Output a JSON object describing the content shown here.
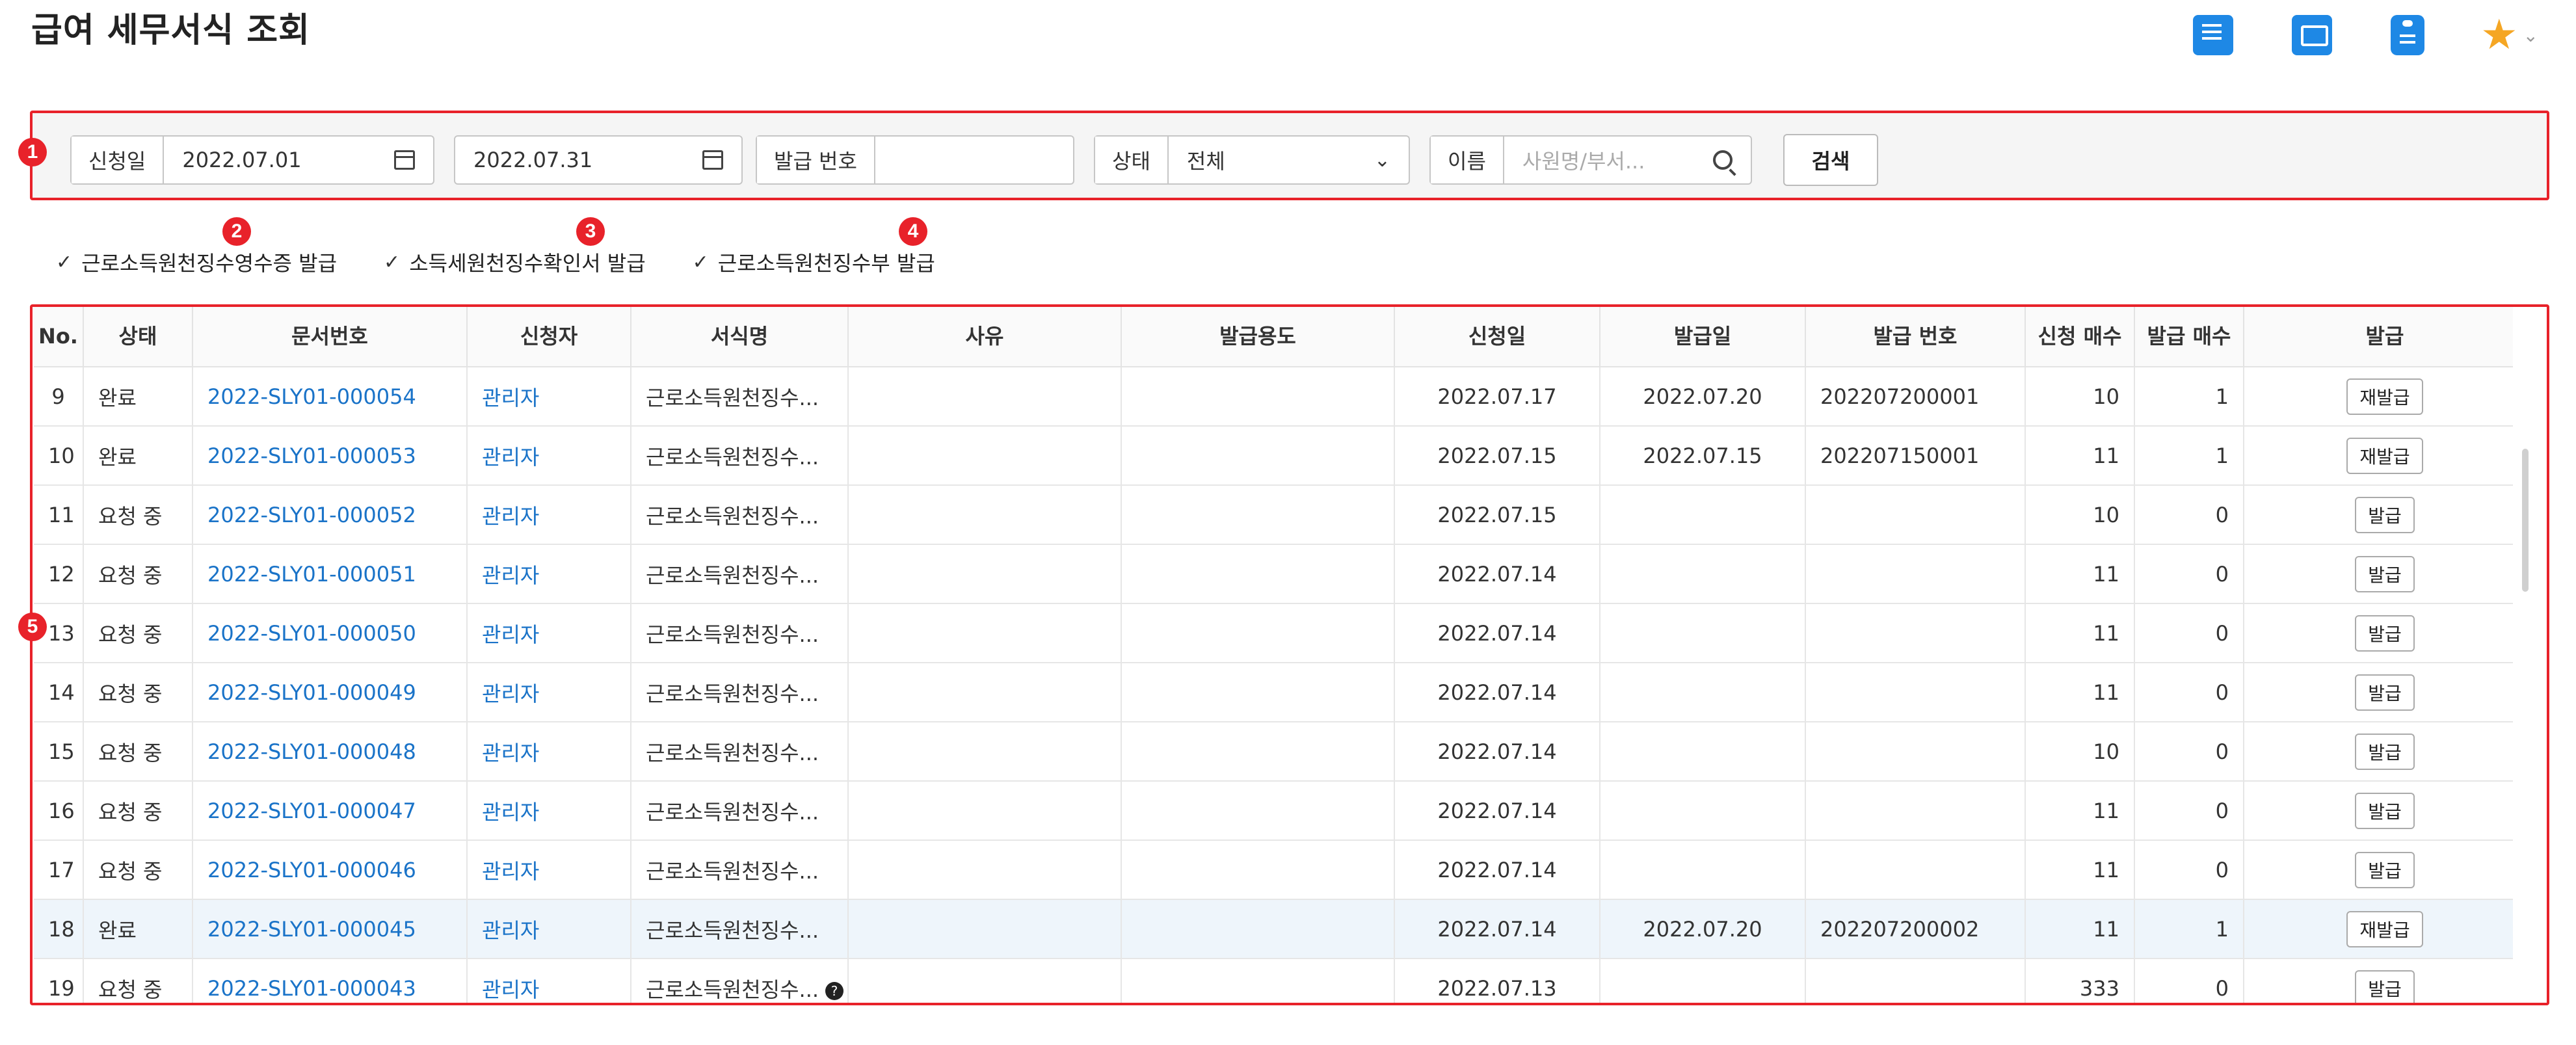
{
  "page": {
    "title": "급여 세무서식 조회"
  },
  "top_icons": [
    "document-icon",
    "message-icon",
    "clipboard-icon",
    "favorite-star-icon"
  ],
  "accent": "#1e88e5",
  "annotation_color": "#e8222a",
  "badges": [
    "1",
    "2",
    "3",
    "4",
    "5"
  ],
  "filters": {
    "date_label": "신청일",
    "date_from": "2022.07.01",
    "date_sep": "~",
    "date_to": "2022.07.31",
    "issue_no_label": "발급 번호",
    "issue_no_value": "",
    "status_label": "상태",
    "status_value": "전체",
    "name_label": "이름",
    "name_placeholder": "사원명/부서...",
    "search_button": "검색"
  },
  "issue_actions": [
    {
      "label": "근로소득원천징수영수증 발급"
    },
    {
      "label": "소득세원천징수확인서 발급"
    },
    {
      "label": "근로소득원천징수부 발급"
    }
  ],
  "table": {
    "columns": [
      "No.",
      "상태",
      "문서번호",
      "신청자",
      "서식명",
      "사유",
      "발급용도",
      "신청일",
      "발급일",
      "발급 번호",
      "신청 매수",
      "발급 매수",
      "발급"
    ],
    "rows": [
      {
        "no": "9",
        "status": "완료",
        "doc_no": "2022-SLY01-000054",
        "applicant": "관리자",
        "form": "근로소득원천징수...",
        "reason": "",
        "purpose": "",
        "applied": "2022.07.17",
        "issued": "2022.07.20",
        "issue_no": "202207200001",
        "req_count": "10",
        "issue_count": "1",
        "action": "재발급"
      },
      {
        "no": "10",
        "status": "완료",
        "doc_no": "2022-SLY01-000053",
        "applicant": "관리자",
        "form": "근로소득원천징수...",
        "reason": "",
        "purpose": "",
        "applied": "2022.07.15",
        "issued": "2022.07.15",
        "issue_no": "202207150001",
        "req_count": "11",
        "issue_count": "1",
        "action": "재발급"
      },
      {
        "no": "11",
        "status": "요청 중",
        "doc_no": "2022-SLY01-000052",
        "applicant": "관리자",
        "form": "근로소득원천징수...",
        "reason": "",
        "purpose": "",
        "applied": "2022.07.15",
        "issued": "",
        "issue_no": "",
        "req_count": "10",
        "issue_count": "0",
        "action": "발급"
      },
      {
        "no": "12",
        "status": "요청 중",
        "doc_no": "2022-SLY01-000051",
        "applicant": "관리자",
        "form": "근로소득원천징수...",
        "reason": "",
        "purpose": "",
        "applied": "2022.07.14",
        "issued": "",
        "issue_no": "",
        "req_count": "11",
        "issue_count": "0",
        "action": "발급"
      },
      {
        "no": "13",
        "status": "요청 중",
        "doc_no": "2022-SLY01-000050",
        "applicant": "관리자",
        "form": "근로소득원천징수...",
        "reason": "",
        "purpose": "",
        "applied": "2022.07.14",
        "issued": "",
        "issue_no": "",
        "req_count": "11",
        "issue_count": "0",
        "action": "발급"
      },
      {
        "no": "14",
        "status": "요청 중",
        "doc_no": "2022-SLY01-000049",
        "applicant": "관리자",
        "form": "근로소득원천징수...",
        "reason": "",
        "purpose": "",
        "applied": "2022.07.14",
        "issued": "",
        "issue_no": "",
        "req_count": "11",
        "issue_count": "0",
        "action": "발급"
      },
      {
        "no": "15",
        "status": "요청 중",
        "doc_no": "2022-SLY01-000048",
        "applicant": "관리자",
        "form": "근로소득원천징수...",
        "reason": "",
        "purpose": "",
        "applied": "2022.07.14",
        "issued": "",
        "issue_no": "",
        "req_count": "10",
        "issue_count": "0",
        "action": "발급"
      },
      {
        "no": "16",
        "status": "요청 중",
        "doc_no": "2022-SLY01-000047",
        "applicant": "관리자",
        "form": "근로소득원천징수...",
        "reason": "",
        "purpose": "",
        "applied": "2022.07.14",
        "issued": "",
        "issue_no": "",
        "req_count": "11",
        "issue_count": "0",
        "action": "발급"
      },
      {
        "no": "17",
        "status": "요청 중",
        "doc_no": "2022-SLY01-000046",
        "applicant": "관리자",
        "form": "근로소득원천징수...",
        "reason": "",
        "purpose": "",
        "applied": "2022.07.14",
        "issued": "",
        "issue_no": "",
        "req_count": "11",
        "issue_count": "0",
        "action": "발급"
      },
      {
        "no": "18",
        "status": "완료",
        "doc_no": "2022-SLY01-000045",
        "applicant": "관리자",
        "form": "근로소득원천징수...",
        "reason": "",
        "purpose": "",
        "applied": "2022.07.14",
        "issued": "2022.07.20",
        "issue_no": "202207200002",
        "req_count": "11",
        "issue_count": "1",
        "action": "재발급",
        "highlight": true
      },
      {
        "no": "19",
        "status": "요청 중",
        "doc_no": "2022-SLY01-000043",
        "applicant": "관리자",
        "form": "근로소득원천징수...",
        "reason": "",
        "purpose": "",
        "applied": "2022.07.13",
        "issued": "",
        "issue_no": "",
        "req_count": "333",
        "issue_count": "0",
        "action": "발급",
        "help": "?"
      }
    ]
  }
}
